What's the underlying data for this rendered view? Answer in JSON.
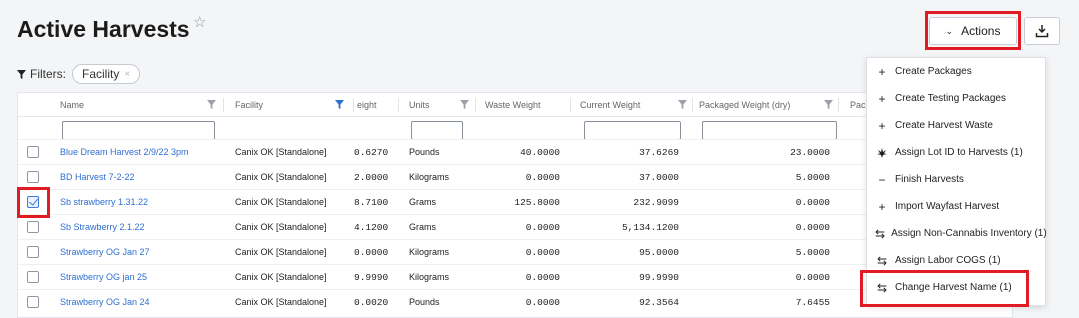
{
  "page": {
    "title": "Active Harvests"
  },
  "filters": {
    "label": "Filters:",
    "chips": [
      {
        "label": "Facility",
        "remove": "×"
      }
    ]
  },
  "toolbar": {
    "actions_label": "Actions"
  },
  "table": {
    "headers": [
      "Name",
      "Facility",
      "eight",
      "Units",
      "Waste Weight",
      "Current Weight",
      "Packaged Weight (dry)",
      "Pac"
    ],
    "rows": [
      {
        "checked": false,
        "name": "Blue Dream Harvest 2/9/22 3pm",
        "facility": "Canix OK [Standalone]",
        "weight": "0.6270",
        "units": "Pounds",
        "waste": "40.0000",
        "current": "37.6269",
        "packaged": "23.0000"
      },
      {
        "checked": false,
        "name": "BD Harvest 7-2-22",
        "facility": "Canix OK [Standalone]",
        "weight": "2.0000",
        "units": "Kilograms",
        "waste": "0.0000",
        "current": "37.0000",
        "packaged": "5.0000"
      },
      {
        "checked": true,
        "name": "Sb strawberry 1.31.22",
        "facility": "Canix OK [Standalone]",
        "weight": "8.7100",
        "units": "Grams",
        "waste": "125.8000",
        "current": "232.9099",
        "packaged": "0.0000"
      },
      {
        "checked": false,
        "name": "Sb Strawberry 2.1.22",
        "facility": "Canix OK [Standalone]",
        "weight": "4.1200",
        "units": "Grams",
        "waste": "0.0000",
        "current": "5,134.1200",
        "packaged": "0.0000"
      },
      {
        "checked": false,
        "name": "Strawberry OG Jan 27",
        "facility": "Canix OK [Standalone]",
        "weight": "0.0000",
        "units": "Kilograms",
        "waste": "0.0000",
        "current": "95.0000",
        "packaged": "5.0000"
      },
      {
        "checked": false,
        "name": "Strawberry OG jan 25",
        "facility": "Canix OK [Standalone]",
        "weight": "9.9990",
        "units": "Kilograms",
        "waste": "0.0000",
        "current": "99.9990",
        "packaged": "0.0000"
      },
      {
        "checked": false,
        "name": "Strawberry OG Jan 24",
        "facility": "Canix OK [Standalone]",
        "weight": "0.0020",
        "units": "Pounds",
        "waste": "0.0000",
        "current": "92.3564",
        "packaged": "7.6455"
      }
    ]
  },
  "menu": {
    "items": [
      {
        "label": "Create Packages",
        "icon": "plus-icon"
      },
      {
        "label": "Create Testing Packages",
        "icon": "plus-icon"
      },
      {
        "label": "Create Harvest Waste",
        "icon": "plus-icon"
      },
      {
        "label": "Assign Lot ID to Harvests (1)",
        "icon": "cannabis-leaf-icon"
      },
      {
        "label": "Finish Harvests",
        "icon": "minus-icon"
      },
      {
        "label": "Import Wayfast Harvest",
        "icon": "plus-icon"
      },
      {
        "label": "Assign Non-Cannabis Inventory (1)",
        "icon": "swap-arrows-icon"
      },
      {
        "label": "Assign Labor COGS (1)",
        "icon": "swap-arrows-icon"
      },
      {
        "label": "Change Harvest Name (1)",
        "icon": "swap-arrows-icon"
      }
    ]
  },
  "colors": {
    "link": "#2f6fd1",
    "highlight": "#e01b24",
    "checkbox_checked": "#3b7be0"
  }
}
